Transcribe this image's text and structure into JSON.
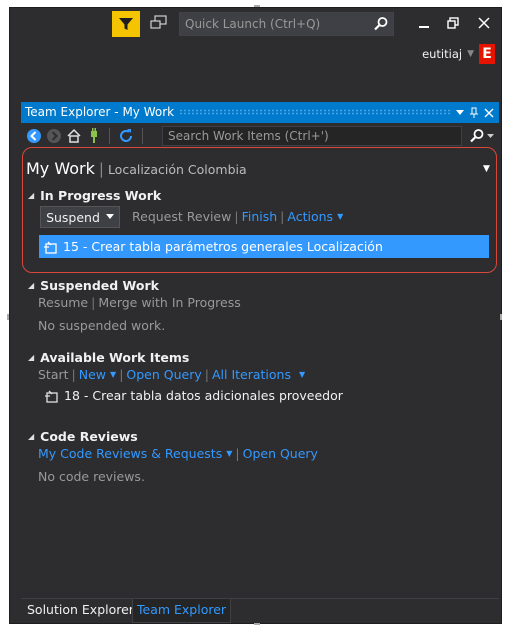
{
  "titlebar": {
    "quick_launch_placeholder": "Quick Launch (Ctrl+Q)",
    "user_name": "eutitiaj",
    "avatar_letter": "E",
    "icons": [
      "filter-icon",
      "feedback-icon",
      "search-icon",
      "minimize-icon",
      "restore-icon",
      "close-icon"
    ]
  },
  "tool_window": {
    "title": "Team Explorer - My Work",
    "search_placeholder": "Search Work Items (Ctrl+')",
    "toolbar_icons": [
      "back-icon",
      "forward-icon",
      "home-icon",
      "connect-icon",
      "refresh-icon"
    ]
  },
  "mywork": {
    "title": "My Work",
    "subtitle": "Localización Colombia"
  },
  "in_progress": {
    "header": "In Progress Work",
    "suspend_label": "Suspend",
    "request_review": "Request Review",
    "finish": "Finish",
    "actions": "Actions",
    "item": "15 - Crear tabla parámetros generales Localización"
  },
  "suspended": {
    "header": "Suspended Work",
    "resume": "Resume",
    "merge": "Merge with In Progress",
    "empty": "No suspended work."
  },
  "available": {
    "header": "Available Work Items",
    "start": "Start",
    "new": "New",
    "open_query": "Open Query",
    "all_iterations": "All Iterations",
    "item": "18 - Crear tabla datos adicionales proveedor"
  },
  "code_reviews": {
    "header": "Code Reviews",
    "my_reviews": "My Code Reviews & Requests",
    "open_query": "Open Query",
    "empty": "No code reviews."
  },
  "tabs": {
    "solution_explorer": "Solution Explorer",
    "team_explorer": "Team Explorer"
  },
  "colors": {
    "accent": "#007acc",
    "link": "#3399ff",
    "background": "#2d2d30",
    "highlight_border": "#d9473a",
    "filter_badge": "#f5c400",
    "avatar": "#e51400"
  }
}
